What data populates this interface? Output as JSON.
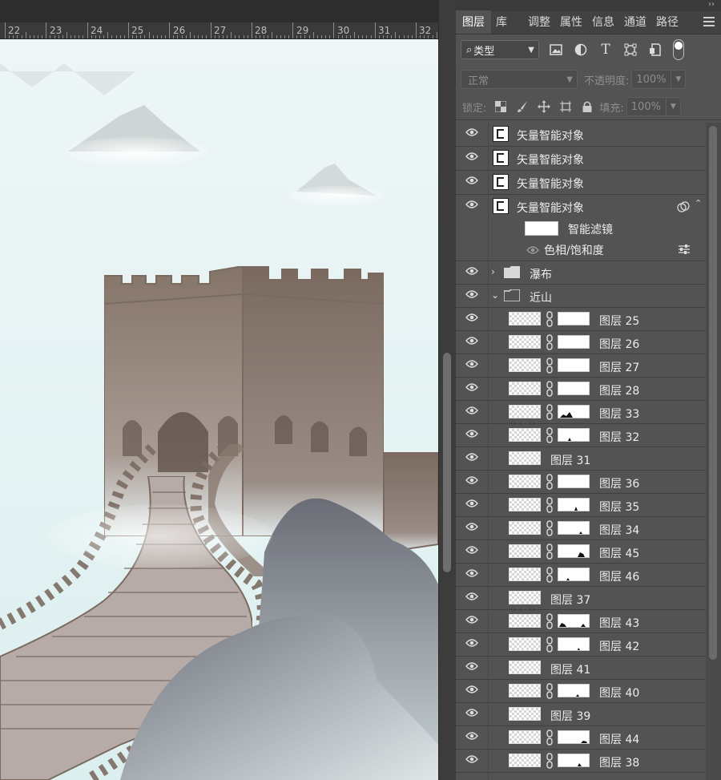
{
  "ruler": {
    "marks": [
      "22",
      "23",
      "24",
      "25",
      "26",
      "27",
      "28",
      "29",
      "30",
      "31",
      "32"
    ]
  },
  "panel": {
    "tabs": [
      "图层",
      "库",
      "调整",
      "属性",
      "信息",
      "通道",
      "路径"
    ],
    "active_tab": "图层",
    "filter": {
      "kind_label": "类型",
      "search_glyph": "⌕"
    },
    "blend": {
      "mode": "正常",
      "opacity_label": "不透明度:",
      "opacity_value": "100%"
    },
    "lock": {
      "label": "锁定:",
      "fill_label": "填充:",
      "fill_value": "100%"
    },
    "layers": {
      "so1": "矢量智能对象",
      "so2": "矢量智能对象",
      "so3": "矢量智能对象",
      "so4": "矢量智能对象",
      "smart_filter": "智能滤镜",
      "hue_sat": "色相/饱和度",
      "group_waterfall": "瀑布",
      "group_near_mountain": "近山",
      "l25": "图层 25",
      "l26": "图层 26",
      "l27": "图层 27",
      "l28": "图层 28",
      "l33": "图层 33",
      "l32": "图层 32",
      "l31": "图层 31",
      "l36": "图层 36",
      "l35": "图层 35",
      "l34": "图层 34",
      "l45": "图层 45",
      "l46": "图层 46",
      "l37": "图层 37",
      "l43": "图层 43",
      "l42": "图层 42",
      "l41": "图层 41",
      "l40": "图层 40",
      "l39": "图层 39",
      "l44": "图层 44",
      "l38": "图层 38"
    }
  },
  "colors": {
    "panel_bg": "#535353",
    "canvas_sky": "#e6f3f4",
    "wall": "#7f6f66",
    "rock": "#5e626c"
  }
}
